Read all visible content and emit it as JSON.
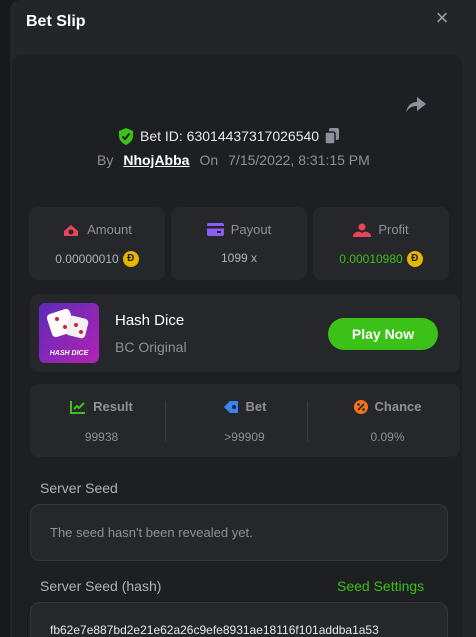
{
  "header": {
    "title": "Bet Slip",
    "close_icon": "close-icon"
  },
  "bet": {
    "id_label": "Bet ID: 63014437317026540",
    "by_label": "By",
    "user": "NhojAbba",
    "on_label": "On",
    "date": "7/15/2022, 8:31:15 PM"
  },
  "stats": [
    {
      "label": "Amount",
      "value": "0.00000010",
      "icon": "amount-icon",
      "coin": true
    },
    {
      "label": "Payout",
      "value": "1099 x",
      "icon": "payout-icon",
      "coin": false
    },
    {
      "label": "Profit",
      "value": "0.00010980",
      "icon": "profit-icon",
      "coin": true
    }
  ],
  "game": {
    "name": "Hash Dice",
    "provider": "BC Original",
    "thumb_text": "HASH DICE",
    "play_label": "Play Now"
  },
  "result": [
    {
      "label": "Result",
      "value": "99938",
      "icon": "result-icon"
    },
    {
      "label": "Bet",
      "value": ">99909",
      "icon": "bet-icon"
    },
    {
      "label": "Chance",
      "value": "0.09%",
      "icon": "chance-icon"
    }
  ],
  "server_seed": {
    "label": "Server Seed",
    "value": "The seed hasn't been revealed yet."
  },
  "server_seed_hash": {
    "label": "Server Seed (hash)",
    "settings_label": "Seed Settings",
    "value": "fb62e7e887bd2e21e62a26c9efe8931ae18116f101addba1a53"
  },
  "coin_symbol": "Ð",
  "colors": {
    "accent": "#3bc117",
    "background": "#17181b",
    "panel": "#232529",
    "card": "#25272b",
    "profit_text": "#3bc117",
    "coin": "#e8b600"
  }
}
